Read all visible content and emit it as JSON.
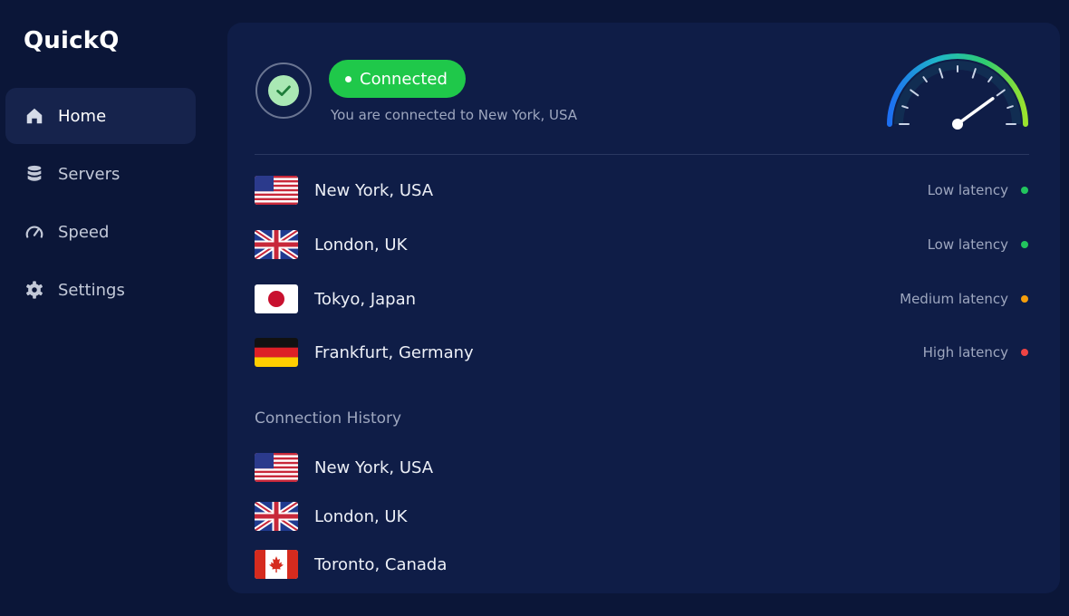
{
  "app": {
    "name": "QuickQ"
  },
  "sidebar": {
    "items": [
      {
        "label": "Home",
        "icon": "home-icon",
        "active": true
      },
      {
        "label": "Servers",
        "icon": "servers-icon",
        "active": false
      },
      {
        "label": "Speed",
        "icon": "speedometer-icon",
        "active": false
      },
      {
        "label": "Settings",
        "icon": "gear-icon",
        "active": false
      }
    ]
  },
  "status": {
    "label": "Connected",
    "message": "You are connected to New York, USA",
    "icon": "check-icon"
  },
  "gauge": {
    "level": 0.8,
    "icon": "speedometer-icon"
  },
  "servers": [
    {
      "location": "New York, USA",
      "flag": "us-flag-icon",
      "latency": "Low latency",
      "color": "#22c55e"
    },
    {
      "location": "London, UK",
      "flag": "uk-flag-icon",
      "latency": "Low latency",
      "color": "#22c55e"
    },
    {
      "location": "Tokyo, Japan",
      "flag": "japan-flag-icon",
      "latency": "Medium latency",
      "color": "#f59e0b"
    },
    {
      "location": "Frankfurt, Germany",
      "flag": "germany-flag-icon",
      "latency": "High latency",
      "color": "#ef4444"
    }
  ],
  "history": {
    "title": "Connection History",
    "items": [
      {
        "location": "New York, USA",
        "flag": "us-flag-icon"
      },
      {
        "location": "London, UK",
        "flag": "uk-flag-icon"
      },
      {
        "location": "Toronto, Canada",
        "flag": "canada-flag-icon"
      }
    ]
  },
  "colors": {
    "accent": "#1fc84a",
    "background": "#0b1638",
    "panel": "#0f1d47"
  }
}
